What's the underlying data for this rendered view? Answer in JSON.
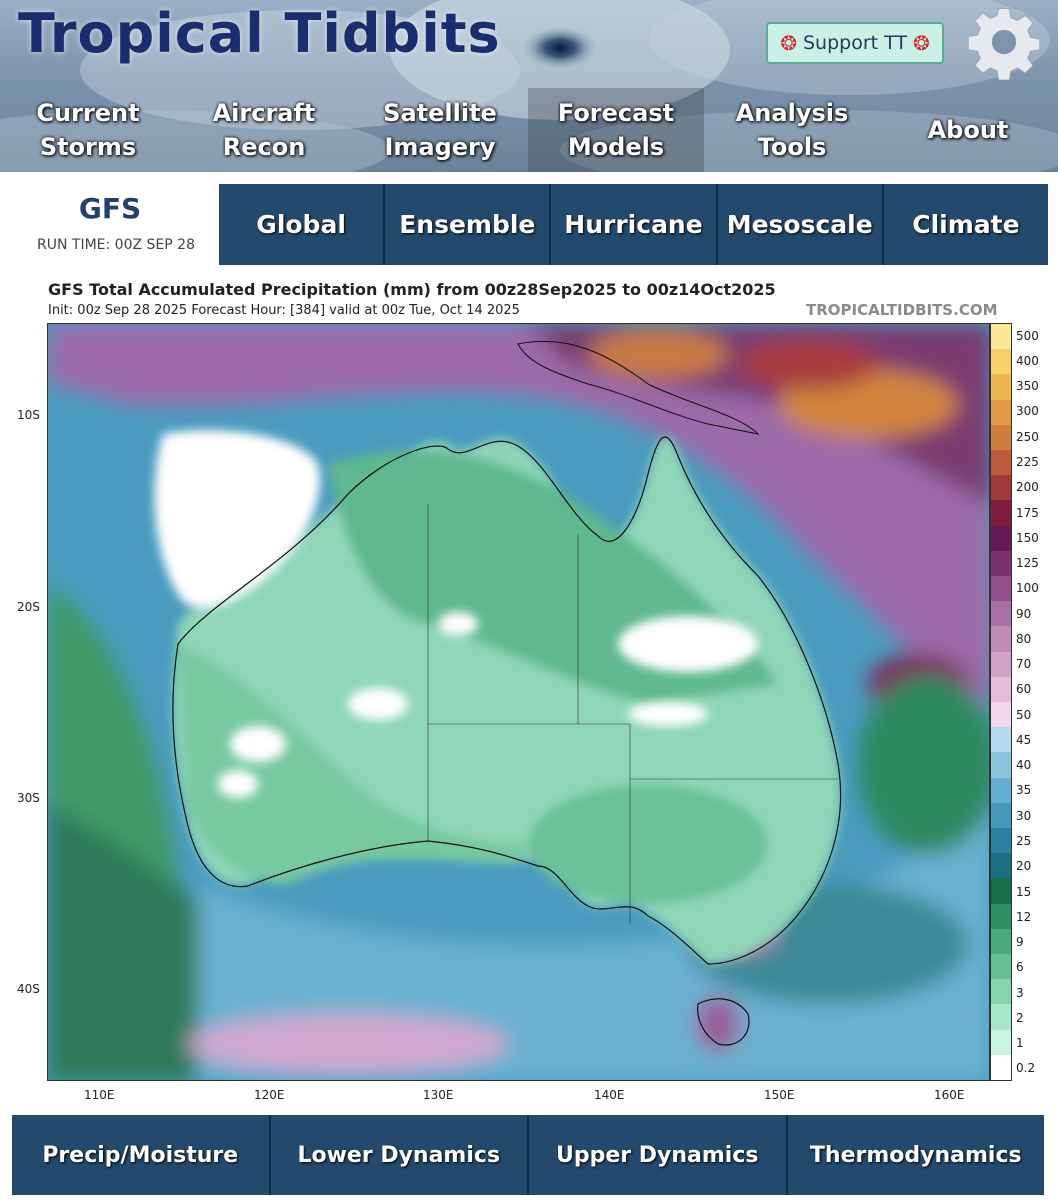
{
  "header": {
    "logo_text": "Tropical Tidbits",
    "support_label": "Support TT",
    "nav": [
      {
        "label": "Current\nStorms"
      },
      {
        "label": "Aircraft\nRecon"
      },
      {
        "label": "Satellite\nImagery"
      },
      {
        "label": "Forecast\nModels"
      },
      {
        "label": "Analysis\nTools"
      },
      {
        "label": "About"
      }
    ]
  },
  "model": {
    "name": "GFS",
    "run_time": "RUN TIME: 00Z SEP 28",
    "tabs": [
      {
        "label": "Global"
      },
      {
        "label": "Ensemble"
      },
      {
        "label": "Hurricane"
      },
      {
        "label": "Mesoscale"
      },
      {
        "label": "Climate"
      }
    ]
  },
  "map": {
    "title": "GFS Total Accumulated Precipitation (mm) from 00z28Sep2025 to 00z14Oct2025",
    "subtitle": "Init: 00z Sep 28 2025   Forecast Hour: [384]   valid at 00z Tue, Oct 14 2025",
    "credit": "TROPICALTIDBITS.COM",
    "lat_labels": [
      "10S",
      "20S",
      "30S",
      "40S"
    ],
    "lon_labels": [
      "110E",
      "120E",
      "130E",
      "140E",
      "150E",
      "160E"
    ],
    "colorbar": {
      "labels": [
        "0.2",
        "1",
        "2",
        "3",
        "6",
        "9",
        "12",
        "15",
        "20",
        "25",
        "30",
        "35",
        "40",
        "45",
        "50",
        "60",
        "70",
        "80",
        "90",
        "100",
        "125",
        "150",
        "175",
        "200",
        "225",
        "250",
        "300",
        "350",
        "400",
        "500"
      ],
      "colors": [
        "#ffffff",
        "#c8f4e0",
        "#a7e6c8",
        "#86d4ad",
        "#66bf93",
        "#4aa97b",
        "#2e8f63",
        "#176e48",
        "#1d6e82",
        "#2b80a0",
        "#4698ba",
        "#66aed0",
        "#8cc4e0",
        "#b4daf0",
        "#f2d6ea",
        "#e2bcd8",
        "#d0a2c6",
        "#be8ab6",
        "#a870a4",
        "#924f8e",
        "#7a3272",
        "#641a56",
        "#801c3c",
        "#a03a38",
        "#bc5a3c",
        "#d07e40",
        "#e09a48",
        "#ecb650",
        "#f6d06a",
        "#fbe79a"
      ]
    }
  },
  "bottom_nav": [
    {
      "label": "Precip/Moisture"
    },
    {
      "label": "Lower Dynamics"
    },
    {
      "label": "Upper Dynamics"
    },
    {
      "label": "Thermodynamics"
    }
  ]
}
